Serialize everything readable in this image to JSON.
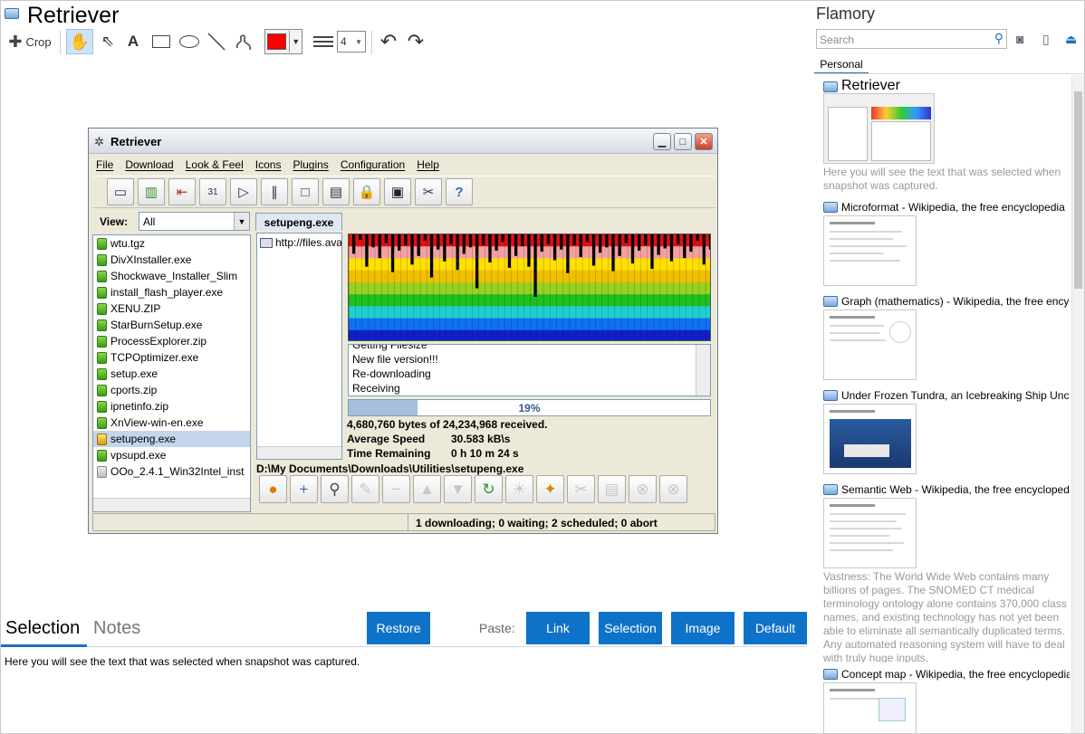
{
  "app": {
    "title": "Retriever"
  },
  "toolbar": {
    "crop_label": "Crop",
    "line_width": "4",
    "colors": {
      "pen": "#ff0000",
      "accent": "#0f72c9"
    }
  },
  "screenshot": {
    "window_title": "Retriever",
    "menu": [
      "File",
      "Download",
      "Look & Feel",
      "Icons",
      "Plugins",
      "Configuration",
      "Help"
    ],
    "view_label": "View:",
    "view_value": "All",
    "files": [
      {
        "name": "wtu.tgz",
        "state": "green"
      },
      {
        "name": "DivXInstaller.exe",
        "state": "green"
      },
      {
        "name": "Shockwave_Installer_Slim",
        "state": "green"
      },
      {
        "name": "install_flash_player.exe",
        "state": "green"
      },
      {
        "name": "XENU.ZIP",
        "state": "green"
      },
      {
        "name": "StarBurnSetup.exe",
        "state": "green"
      },
      {
        "name": "ProcessExplorer.zip",
        "state": "green"
      },
      {
        "name": "TCPOptimizer.exe",
        "state": "green"
      },
      {
        "name": "setup.exe",
        "state": "green"
      },
      {
        "name": "cports.zip",
        "state": "green"
      },
      {
        "name": "ipnetinfo.zip",
        "state": "green"
      },
      {
        "name": "XnView-win-en.exe",
        "state": "green"
      },
      {
        "name": "setupeng.exe",
        "state": "yellow"
      },
      {
        "name": "vpsupd.exe",
        "state": "green"
      },
      {
        "name": "OOo_2.4.1_Win32Intel_inst",
        "state": "gray"
      }
    ],
    "selected_tab": "setupeng.exe",
    "url": "http://files.ava",
    "log": [
      "Getting Filesize",
      "New file version!!!",
      "Re-downloading",
      "Receiving"
    ],
    "progress_percent": 19,
    "progress_label": "19%",
    "received": "4,680,760 bytes of 24,234,968 received.",
    "avg_speed_label": "Average Speed",
    "avg_speed_value": "30.583 kB\\s",
    "time_remaining_label": "Time Remaining",
    "time_remaining_value": "0 h 10 m 24 s",
    "path": "D:\\My Documents\\Downloads\\Utilities\\setupeng.exe",
    "status": "1 downloading; 0 waiting; 2 scheduled; 0 abort"
  },
  "bottom": {
    "tab_selection": "Selection",
    "tab_notes": "Notes",
    "restore_label": "Restore",
    "paste_label": "Paste:",
    "paste_buttons": [
      "Link",
      "Selection",
      "Image",
      "Default"
    ],
    "selection_text": "Here you will see the text that was selected when snapshot was captured."
  },
  "sidebar": {
    "title": "Flamory",
    "search_placeholder": "Search",
    "tab_personal": "Personal",
    "snapshots": [
      {
        "title": "Retriever",
        "desc": "Here you will see the text that was selected when snapshot was captured."
      },
      {
        "title": "Microformat - Wikipedia, the free encyclopedia",
        "desc": ""
      },
      {
        "title": "Graph (mathematics) - Wikipedia, the free ency",
        "desc": ""
      },
      {
        "title": "Under Frozen Tundra, an Icebreaking Ship Unco",
        "desc": ""
      },
      {
        "title": "Semantic Web - Wikipedia, the free encycloped",
        "desc": "Vastness: The World Wide Web contains many billions of pages. The SNOMED CT medical terminology ontology alone contains 370,000 class names, and existing technology has not yet been able to eliminate all semantically duplicated terms. Any automated reasoning system will have to deal with truly huge inputs."
      },
      {
        "title": "Concept map - Wikipedia, the free encyclopedia",
        "desc": ""
      }
    ]
  }
}
